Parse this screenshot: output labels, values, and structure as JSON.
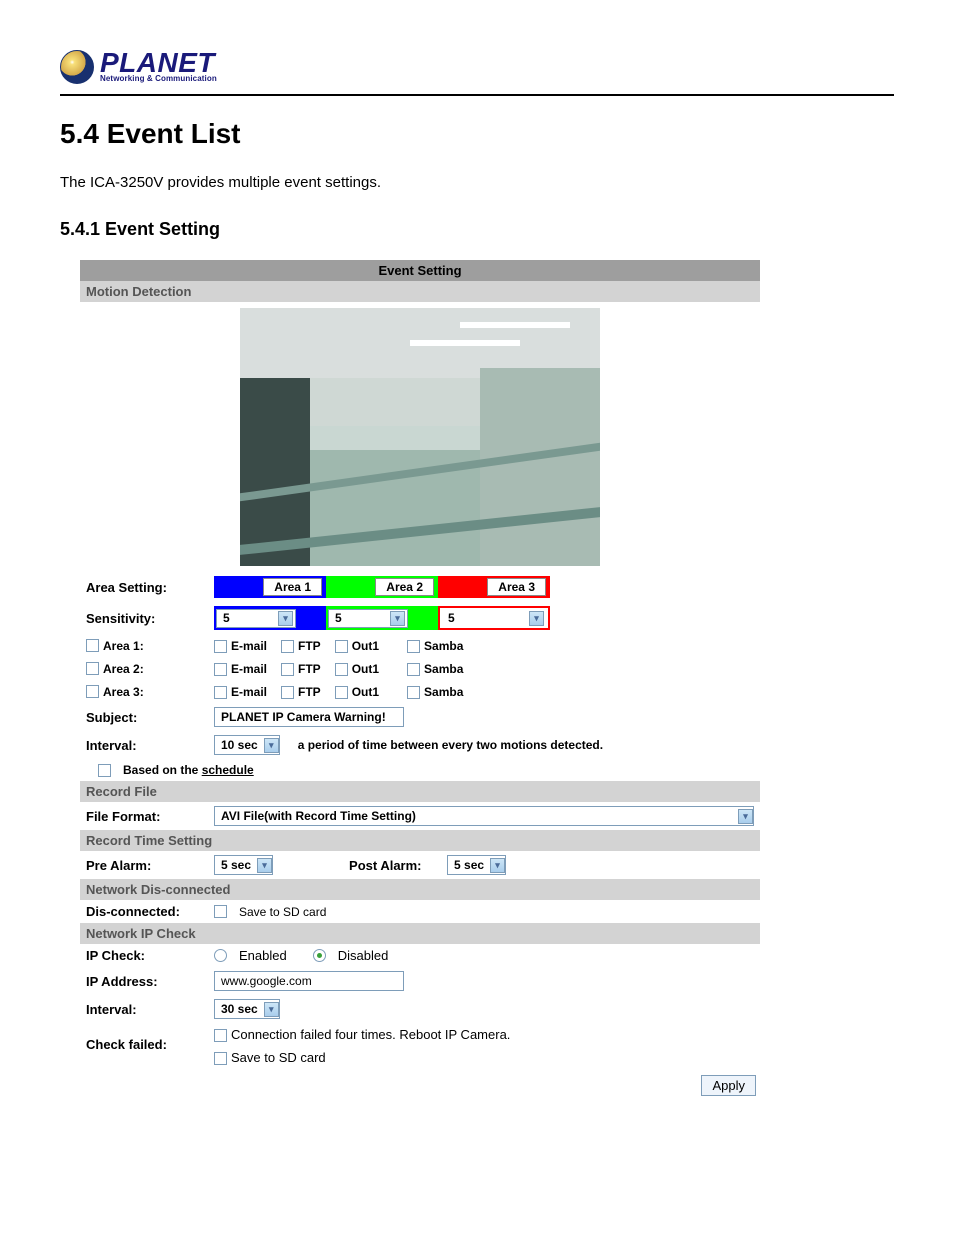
{
  "logo": {
    "brand": "PLANET",
    "tagline": "Networking & Communication"
  },
  "section_title": "5.4 Event List",
  "intro": "The ICA-3250V provides multiple event settings.",
  "subsection_title": "5.4.1 Event Setting",
  "panel": {
    "title": "Event Setting",
    "motion_detection": {
      "header": "Motion Detection",
      "area_setting_label": "Area Setting:",
      "sensitivity_label": "Sensitivity:",
      "areas": [
        {
          "name": "Area 1",
          "sens": "5",
          "color": "blue"
        },
        {
          "name": "Area 2",
          "sens": "5",
          "color": "green"
        },
        {
          "name": "Area 3",
          "sens": "5",
          "color": "red"
        }
      ],
      "area_rows": [
        {
          "label": "Area 1:",
          "opts": [
            "E-mail",
            "FTP",
            "Out1",
            "Samba"
          ]
        },
        {
          "label": "Area 2:",
          "opts": [
            "E-mail",
            "FTP",
            "Out1",
            "Samba"
          ]
        },
        {
          "label": "Area 3:",
          "opts": [
            "E-mail",
            "FTP",
            "Out1",
            "Samba"
          ]
        }
      ],
      "subject_label": "Subject:",
      "subject_value": "PLANET IP Camera Warning!",
      "interval_label": "Interval:",
      "interval_value": "10 sec",
      "interval_note": "a period of time between every two motions detected.",
      "schedule_prefix": "Based on the ",
      "schedule_link": "schedule"
    },
    "record_file": {
      "header": "Record File",
      "format_label": "File Format:",
      "format_value": "AVI File(with Record Time Setting)"
    },
    "record_time": {
      "header": "Record Time Setting",
      "pre_label": "Pre Alarm:",
      "pre_value": "5 sec",
      "post_label": "Post Alarm:",
      "post_value": "5 sec"
    },
    "net_disc": {
      "header": "Network Dis-connected",
      "label": "Dis-connected:",
      "opt": "Save to SD card"
    },
    "ip_check": {
      "header": "Network IP Check",
      "check_label": "IP Check:",
      "enabled": "Enabled",
      "disabled": "Disabled",
      "addr_label": "IP Address:",
      "addr_value": "www.google.com",
      "interval_label": "Interval:",
      "interval_value": "30 sec",
      "fail_label": "Check failed:",
      "fail_opt1": "Connection failed four times. Reboot IP Camera.",
      "fail_opt2": "Save to SD card"
    },
    "apply": "Apply"
  }
}
